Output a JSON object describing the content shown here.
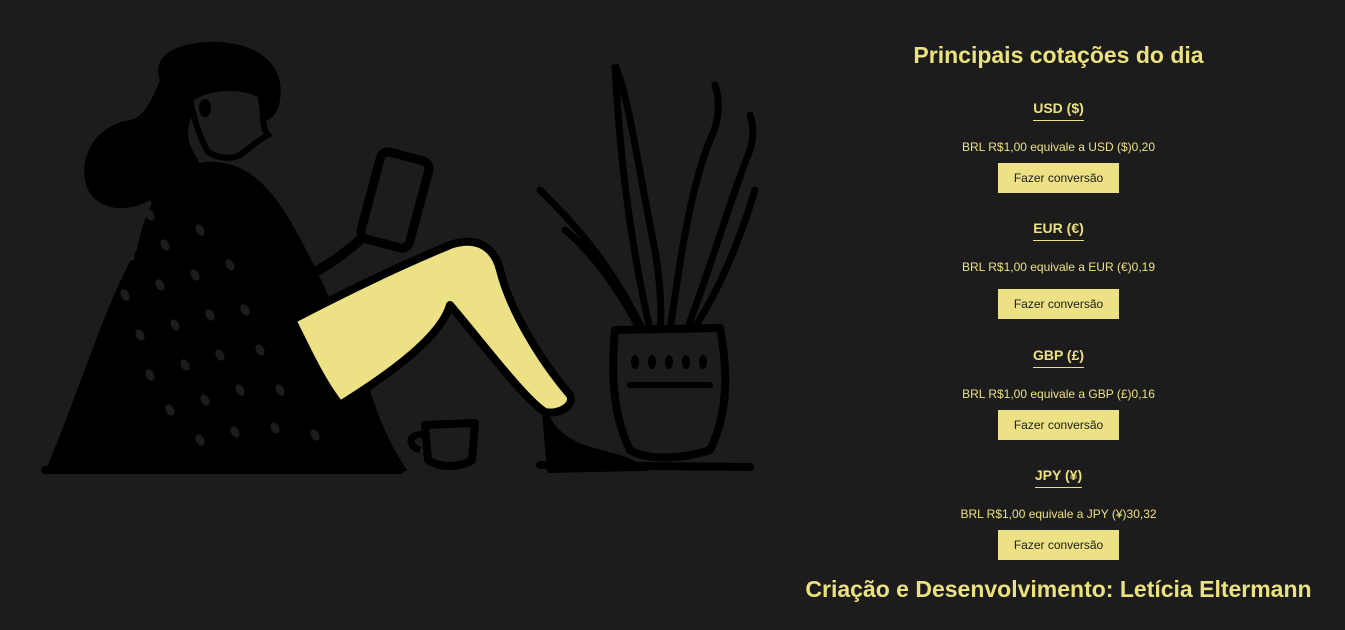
{
  "header": {
    "title": "Principais cotações do dia"
  },
  "rates": [
    {
      "code": "USD ($)",
      "text": "BRL R$1,00 equivale a USD ($)0,20",
      "button_label": "Fazer conversão"
    },
    {
      "code": "EUR (€)",
      "text": "BRL R$1,00 equivale a EUR (€)0,19",
      "button_label": "Fazer conversão"
    },
    {
      "code": "GBP (£)",
      "text": "BRL R$1,00 equivale a GBP (£)0,16",
      "button_label": "Fazer conversão"
    },
    {
      "code": "JPY (¥)",
      "text": "BRL R$1,00 equivale a JPY (¥)30,32",
      "button_label": "Fazer conversão"
    }
  ],
  "footer": {
    "credit": "Criação e Desenvolvimento: Letícia Eltermann"
  },
  "colors": {
    "background": "#1c1c1c",
    "accent": "#ece17f",
    "ink": "#000000"
  },
  "illustration": {
    "icon": "woman-reading-phone-illustration"
  }
}
